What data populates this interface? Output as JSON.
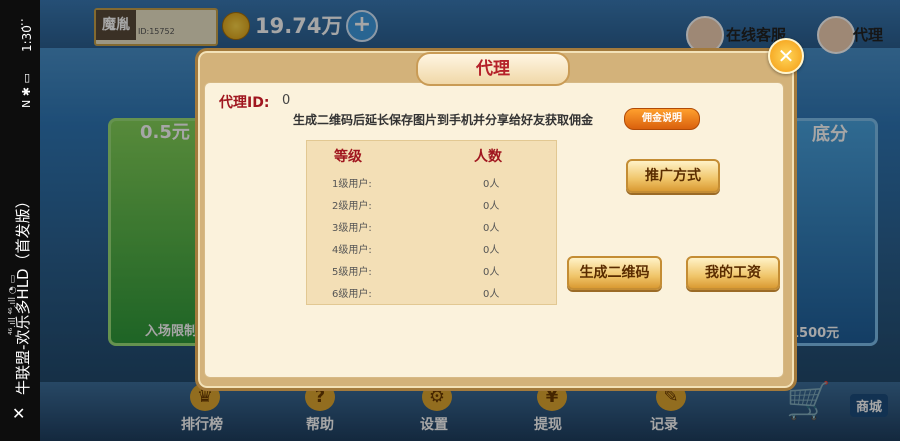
{
  "status_bar": {
    "time": "1:30",
    "icons_text": "N ✱ ▭",
    "signal_text": "⁴⁶.ıll ⁴⁶.ıll ◔ ▭",
    "app_title": "牛联盟-欢乐多HLD（首发版）",
    "close_symbol": "✕",
    "more_symbol": "⋮"
  },
  "header": {
    "avatar_name": "魔胤",
    "user_id": "ID:15752",
    "coins": "19.74万",
    "add_symbol": "+",
    "customer_service": "在线客服",
    "agent": "代理"
  },
  "lobby": {
    "left_card_top": "0.5元",
    "left_card_bottom": "入场限制",
    "right_card_top": "底分",
    "right_card_bottom": "1500元",
    "nav": [
      {
        "label": "排行榜",
        "icon": "trophy-icon",
        "glyph": "♛"
      },
      {
        "label": "帮助",
        "icon": "help-icon",
        "glyph": "?"
      },
      {
        "label": "设置",
        "icon": "gear-icon",
        "glyph": "⚙"
      },
      {
        "label": "提现",
        "icon": "withdraw-icon",
        "glyph": "¥"
      },
      {
        "label": "记录",
        "icon": "record-icon",
        "glyph": "✎"
      }
    ],
    "shop": "商城",
    "cart_glyph": "🛒"
  },
  "modal": {
    "title": "代理",
    "close_symbol": "✕",
    "agent_id_label": "代理ID:",
    "agent_id_value": "0",
    "description": "生成二维码后延长保存图片到手机并分享给好友获取佣金",
    "commission_info_button": "佣金说明",
    "table": {
      "headers": [
        "等级",
        "人数"
      ],
      "rows": [
        {
          "level": "1级用户:",
          "count": "0人"
        },
        {
          "level": "2级用户:",
          "count": "0人"
        },
        {
          "level": "3级用户:",
          "count": "0人"
        },
        {
          "level": "4级用户:",
          "count": "0人"
        },
        {
          "level": "5级用户:",
          "count": "0人"
        },
        {
          "level": "6级用户:",
          "count": "0人"
        }
      ]
    },
    "promote_button": "推广方式",
    "qr_button": "生成二维码",
    "salary_button": "我的工资"
  }
}
